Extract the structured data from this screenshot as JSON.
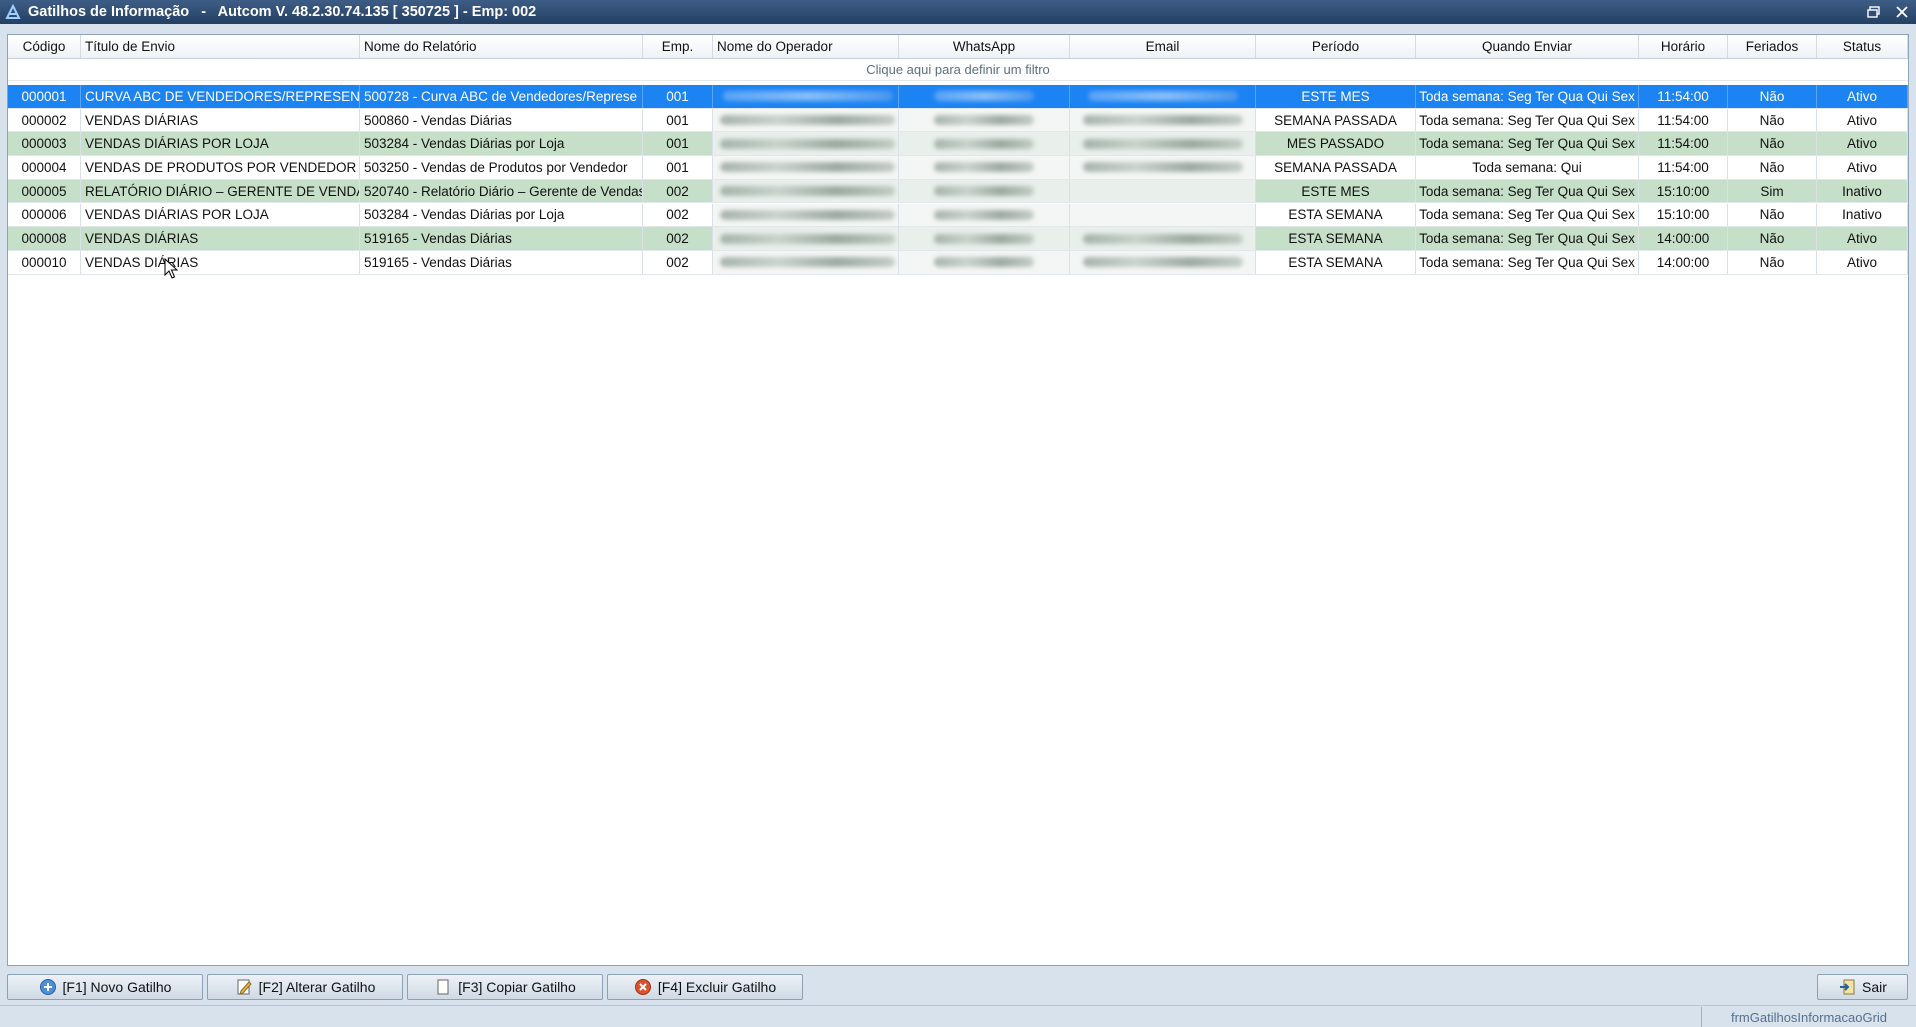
{
  "window": {
    "title": "Gatilhos de Informação   -   Autcom V. 48.2.30.74.135 [ 350725 ] - Emp: 002"
  },
  "grid": {
    "columns": [
      "Código",
      "Título de Envio",
      "Nome do Relatório",
      "Emp.",
      "Nome do Operador",
      "WhatsApp",
      "Email",
      "Período",
      "Quando Enviar",
      "Horário",
      "Feriados",
      "Status"
    ],
    "filter_hint": "Clique aqui para definir um filtro",
    "rows": [
      {
        "codigo": "000001",
        "titulo": "CURVA ABC DE VENDEDORES/REPRESENTA",
        "relatorio": "500728 - Curva ABC de Vendedores/Represe",
        "emp": "001",
        "periodo": "ESTE MES",
        "quando": "Toda semana: Seg Ter Qua Qui Sex",
        "horario": "11:54:00",
        "feriados": "Não",
        "status": "Ativo"
      },
      {
        "codigo": "000002",
        "titulo": "VENDAS DIÁRIAS",
        "relatorio": "500860 - Vendas Diárias",
        "emp": "001",
        "periodo": "SEMANA PASSADA",
        "quando": "Toda semana: Seg Ter Qua Qui Sex",
        "horario": "11:54:00",
        "feriados": "Não",
        "status": "Ativo"
      },
      {
        "codigo": "000003",
        "titulo": "VENDAS DIÁRIAS POR LOJA",
        "relatorio": "503284 - Vendas Diárias por Loja",
        "emp": "001",
        "periodo": "MES PASSADO",
        "quando": "Toda semana: Seg Ter Qua Qui Sex",
        "horario": "11:54:00",
        "feriados": "Não",
        "status": "Ativo"
      },
      {
        "codigo": "000004",
        "titulo": "VENDAS DE PRODUTOS POR VENDEDOR",
        "relatorio": "503250 - Vendas de Produtos por Vendedor",
        "emp": "001",
        "periodo": "SEMANA PASSADA",
        "quando": "Toda semana: Qui",
        "horario": "11:54:00",
        "feriados": "Não",
        "status": "Ativo"
      },
      {
        "codigo": "000005",
        "titulo": "RELATÓRIO DIÁRIO – GERENTE DE VENDAS",
        "relatorio": "520740 - Relatório Diário – Gerente de Vendas",
        "emp": "002",
        "periodo": "ESTE MES",
        "quando": "Toda semana: Seg Ter Qua Qui Sex",
        "horario": "15:10:00",
        "feriados": "Sim",
        "status": "Inativo"
      },
      {
        "codigo": "000006",
        "titulo": "VENDAS DIÁRIAS POR LOJA",
        "relatorio": "503284 - Vendas Diárias por Loja",
        "emp": "002",
        "periodo": "ESTA SEMANA",
        "quando": "Toda semana: Seg Ter Qua Qui Sex",
        "horario": "15:10:00",
        "feriados": "Não",
        "status": "Inativo"
      },
      {
        "codigo": "000008",
        "titulo": "VENDAS DIÁRIAS",
        "relatorio": "519165 - Vendas Diárias",
        "emp": "002",
        "periodo": "ESTA SEMANA",
        "quando": "Toda semana: Seg Ter Qua Qui Sex",
        "horario": "14:00:00",
        "feriados": "Não",
        "status": "Ativo"
      },
      {
        "codigo": "000010",
        "titulo": "VENDAS DIÁRIAS",
        "relatorio": "519165 - Vendas Diárias",
        "emp": "002",
        "periodo": "ESTA SEMANA",
        "quando": "Toda semana: Seg Ter Qua Qui Sex",
        "horario": "14:00:00",
        "feriados": "Não",
        "status": "Ativo"
      }
    ]
  },
  "toolbar": {
    "novo": "[F1] Novo Gatilho",
    "alterar": "[F2] Alterar Gatilho",
    "copiar": "[F3] Copiar Gatilho",
    "excluir": "[F4] Excluir Gatilho",
    "sair": "Sair"
  },
  "statusbar": {
    "form_name": "frmGatilhosInformacaoGrid"
  },
  "colors": {
    "selected_row": "#1c83f2",
    "alt_row": "#c6dfc8",
    "titlebar": "#2f4d75"
  }
}
